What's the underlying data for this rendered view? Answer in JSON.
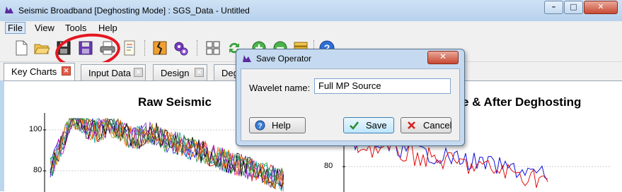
{
  "window": {
    "title": "Seismic Broadband [Deghosting Mode] : SGS_Data - Untitled",
    "min_glyph": "–",
    "max_glyph": "□",
    "close_glyph": "✕"
  },
  "menu": {
    "items": [
      "File",
      "View",
      "Tools",
      "Help"
    ]
  },
  "tabs": [
    {
      "label": "Key Charts"
    },
    {
      "label": "Input Data"
    },
    {
      "label": "Design"
    },
    {
      "label": "Deg"
    }
  ],
  "tab_close_glyph": "✕",
  "charts": {
    "raw": {
      "title": "Raw Seismic",
      "ticks": [
        "100",
        "80"
      ]
    },
    "deghost": {
      "title": "e & After Deghosting",
      "ticks": [
        "80"
      ]
    }
  },
  "dialog": {
    "title": "Save Operator",
    "close_glyph": "✕",
    "field_label": "Wavelet name:",
    "field_value": "Full MP Source",
    "help_label": "Help",
    "save_label": "Save",
    "cancel_label": "Cancel"
  },
  "colors": {
    "annotation_circle": "#e5161f",
    "series_red": "#e01010",
    "series_blue": "#1010d8"
  }
}
